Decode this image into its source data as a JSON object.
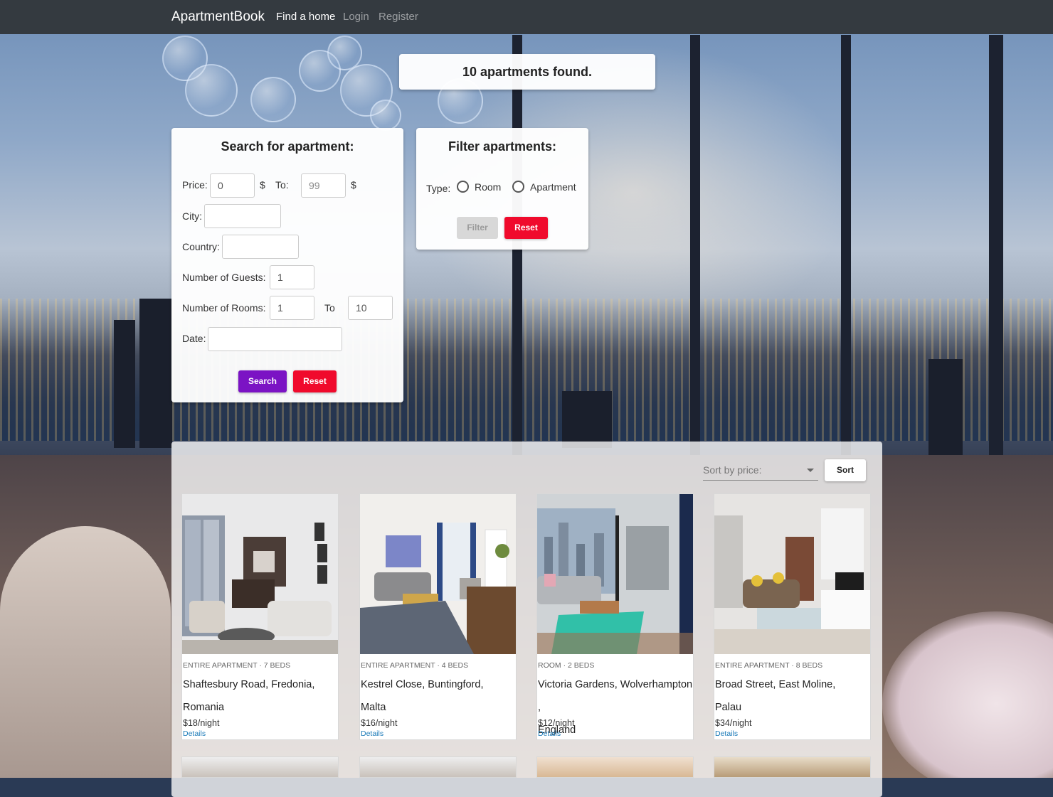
{
  "navbar": {
    "brand": "ApartmentBook",
    "links": [
      {
        "label": "Find a home",
        "active": true
      },
      {
        "label": "Login",
        "active": false
      },
      {
        "label": "Register",
        "active": false
      }
    ]
  },
  "results": {
    "found_text": "10 apartments found."
  },
  "search": {
    "title": "Search for apartment:",
    "price_label": "Price:",
    "price_from": "0",
    "currency": "$",
    "to_label": "To:",
    "price_to_placeholder": "99",
    "city_label": "City:",
    "city_value": "",
    "country_label": "Country:",
    "country_value": "",
    "guests_label": "Number of Guests:",
    "guests_value": "1",
    "rooms_label": "Number of Rooms:",
    "rooms_from": "1",
    "rooms_to_label": "To",
    "rooms_to": "10",
    "date_label": "Date:",
    "date_value": "",
    "search_button": "Search",
    "reset_button": "Reset"
  },
  "filter": {
    "title": "Filter apartments:",
    "type_label": "Type:",
    "options": [
      "Room",
      "Apartment"
    ],
    "filter_button": "Filter",
    "reset_button": "Reset"
  },
  "sort": {
    "placeholder": "Sort by price:",
    "button": "Sort"
  },
  "apartments": [
    {
      "meta": "ENTIRE APARTMENT · 7 BEDS",
      "address": "Shaftesbury Road, Fredonia,",
      "country": "Romania",
      "price": "$18/night",
      "details": "Details"
    },
    {
      "meta": "ENTIRE APARTMENT · 4 BEDS",
      "address": "Kestrel Close, Buntingford,",
      "country": "Malta",
      "price": "$16/night",
      "details": "Details"
    },
    {
      "meta": "ROOM · 2 BEDS",
      "address": "Victoria Gardens, Wolverhampton ,",
      "country": "England",
      "price": "$12/night",
      "details": "Details"
    },
    {
      "meta": "ENTIRE APARTMENT · 8 BEDS",
      "address": "Broad Street, East Moline,",
      "country": "Palau",
      "price": "$34/night",
      "details": "Details"
    }
  ],
  "colors": {
    "navbar": "#343a40",
    "search_button": "#7b13c4",
    "reset_button": "#f00a2c",
    "link": "#1a7ab8"
  }
}
